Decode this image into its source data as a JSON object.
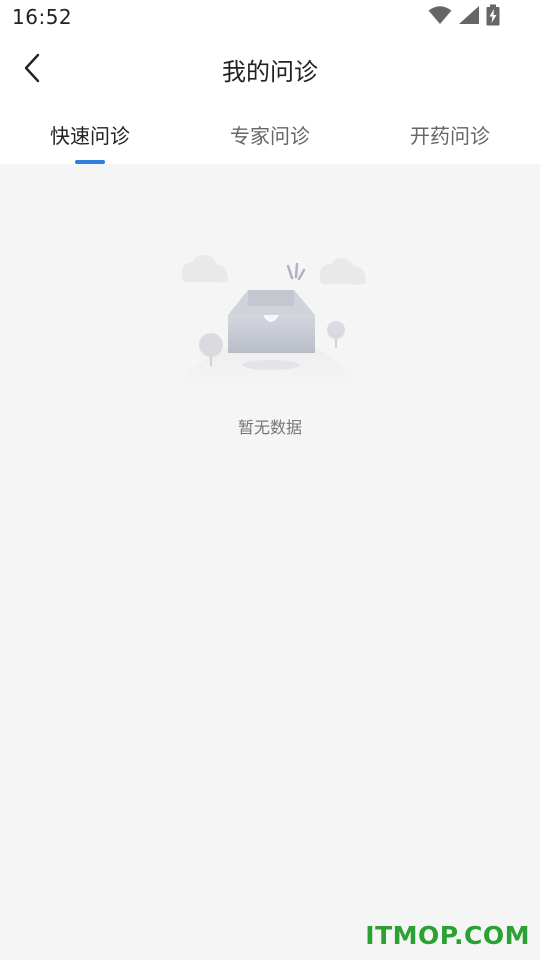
{
  "status_bar": {
    "time": "16:52",
    "icons": [
      "wifi-icon",
      "signal-icon",
      "battery-charging-icon"
    ]
  },
  "header": {
    "title": "我的问诊",
    "back_icon": "chevron-left-icon"
  },
  "tabs": [
    {
      "label": "快速问诊",
      "active": true
    },
    {
      "label": "专家问诊",
      "active": false
    },
    {
      "label": "开药问诊",
      "active": false
    }
  ],
  "empty_state": {
    "message": "暂无数据",
    "illustration": "empty-box-illustration"
  },
  "watermark": "ITMOP.COM",
  "colors": {
    "accent": "#2e7ee0",
    "background": "#f5f5f5",
    "watermark": "#2aa232"
  }
}
